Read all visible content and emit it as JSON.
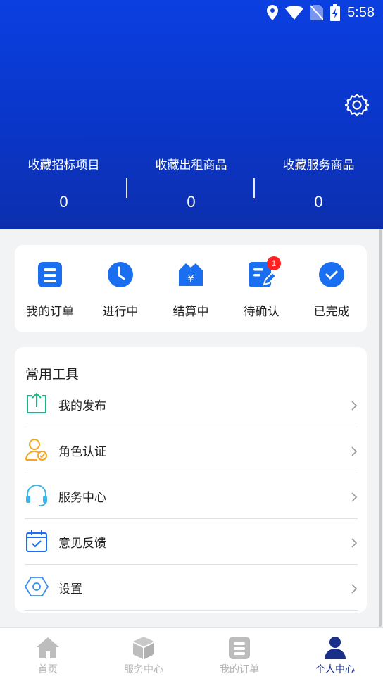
{
  "status_bar": {
    "time": "5:58"
  },
  "stats": [
    {
      "label": "收藏招标项目",
      "value": "0"
    },
    {
      "label": "收藏出租商品",
      "value": "0"
    },
    {
      "label": "收藏服务商品",
      "value": "0"
    }
  ],
  "orders": {
    "items": [
      {
        "label": "我的订单"
      },
      {
        "label": "进行中"
      },
      {
        "label": "结算中"
      },
      {
        "label": "待确认",
        "badge": "1"
      },
      {
        "label": "已完成"
      }
    ]
  },
  "tools": {
    "title": "常用工具",
    "items": [
      {
        "label": "我的发布",
        "icon": "upload-icon"
      },
      {
        "label": "角色认证",
        "icon": "user-verify-icon"
      },
      {
        "label": "服务中心",
        "icon": "headset-icon"
      },
      {
        "label": "意见反馈",
        "icon": "calendar-check-icon"
      },
      {
        "label": "设置",
        "icon": "hexagon-settings-icon"
      }
    ]
  },
  "tabbar": {
    "items": [
      {
        "label": "首页",
        "icon": "home-icon"
      },
      {
        "label": "服务中心",
        "icon": "box-icon"
      },
      {
        "label": "我的订单",
        "icon": "order-icon"
      },
      {
        "label": "个人中心",
        "icon": "person-icon",
        "active": true
      }
    ]
  },
  "colors": {
    "header_top": "#0b3fe0",
    "header_bottom": "#0d2fae",
    "accent": "#1a6ef0",
    "tab_active": "#1a2f8a",
    "tab_inactive": "#b3b3b3",
    "badge": "#ff2222"
  }
}
